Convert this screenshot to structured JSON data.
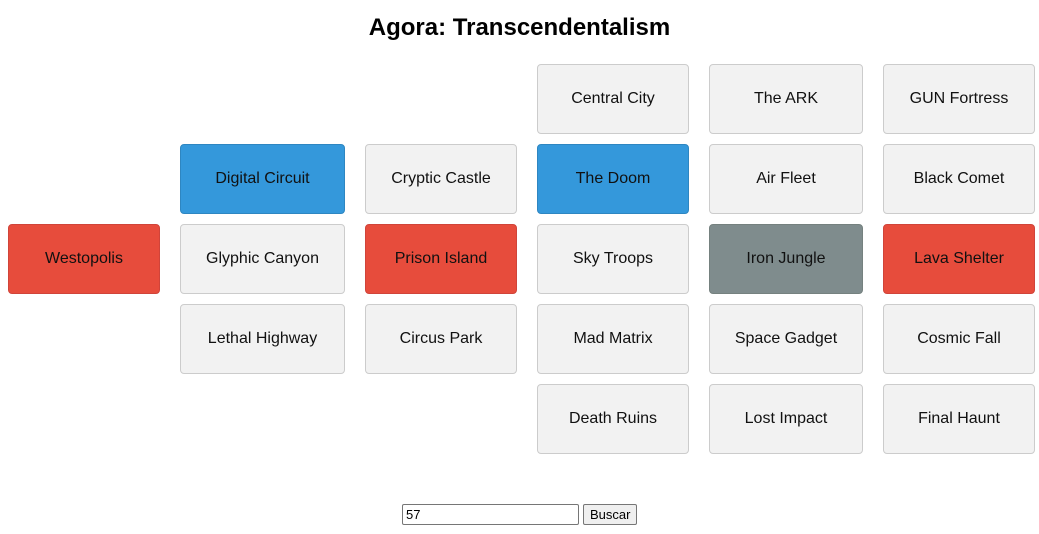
{
  "title": "Agora: Transcendentalism",
  "colors": {
    "default_tile": "#f2f2f2",
    "blue": "#3498db",
    "red": "#e74c3c",
    "gray": "#7f8c8d"
  },
  "tiles": [
    {
      "label": "Central City",
      "state": "default"
    },
    {
      "label": "The ARK",
      "state": "default"
    },
    {
      "label": "GUN Fortress",
      "state": "default"
    },
    {
      "label": "Digital Circuit",
      "state": "blue"
    },
    {
      "label": "Cryptic Castle",
      "state": "default"
    },
    {
      "label": "The Doom",
      "state": "blue"
    },
    {
      "label": "Air Fleet",
      "state": "default"
    },
    {
      "label": "Black Comet",
      "state": "default"
    },
    {
      "label": "Westopolis",
      "state": "red"
    },
    {
      "label": "Glyphic Canyon",
      "state": "default"
    },
    {
      "label": "Prison Island",
      "state": "red"
    },
    {
      "label": "Sky Troops",
      "state": "default"
    },
    {
      "label": "Iron Jungle",
      "state": "gray"
    },
    {
      "label": "Lava Shelter",
      "state": "red"
    },
    {
      "label": "Lethal Highway",
      "state": "default"
    },
    {
      "label": "Circus Park",
      "state": "default"
    },
    {
      "label": "Mad Matrix",
      "state": "default"
    },
    {
      "label": "Space Gadget",
      "state": "default"
    },
    {
      "label": "Cosmic Fall",
      "state": "default"
    },
    {
      "label": "Death Ruins",
      "state": "default"
    },
    {
      "label": "Lost Impact",
      "state": "default"
    },
    {
      "label": "Final Haunt",
      "state": "default"
    }
  ],
  "search": {
    "value": "57",
    "button_label": "Buscar"
  }
}
